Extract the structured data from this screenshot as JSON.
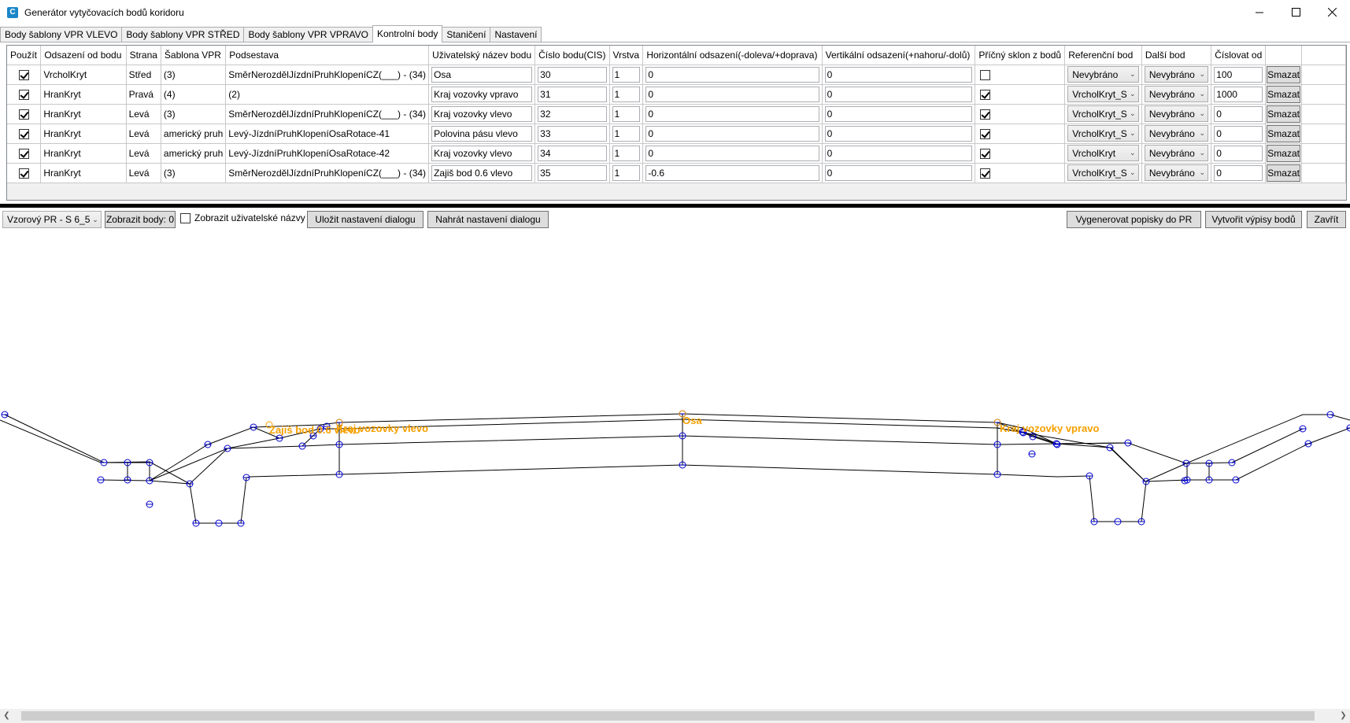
{
  "window": {
    "title": "Generátor vytyčovacích bodů koridoru",
    "minimize_icon": "minimize-icon",
    "maximize_icon": "maximize-icon",
    "close_icon": "close-icon"
  },
  "tabs": [
    {
      "label": "Body šablony VPR VLEVO",
      "active": false
    },
    {
      "label": "Body šablony VPR STŘED",
      "active": false
    },
    {
      "label": "Body šablony VPR VPRAVO",
      "active": false
    },
    {
      "label": "Kontrolní body",
      "active": true
    },
    {
      "label": "Staničení",
      "active": false
    },
    {
      "label": "Nastavení",
      "active": false
    }
  ],
  "grid": {
    "headers": [
      "Použít",
      "Odsazení od bodu",
      "Strana",
      "Šablona VPR",
      "Podsestava",
      "Uživatelský název bodu",
      "Číslo bodu(CIS)",
      "Vrstva",
      "Horizontální odsazení(-doleva/+doprava)",
      "Vertikální odsazení(+nahoru/-dolů)",
      "Příčný sklon z bodů",
      "Referenční bod",
      "Další bod",
      "Číslovat od",
      ""
    ],
    "rows": [
      {
        "use": true,
        "offset_from": "VrcholKryt",
        "side": "Střed",
        "template": "(3)",
        "subassembly": "SměrNerozdělJízdníPruhKlopeníCZ(___) - (34)",
        "user_name": "Osa",
        "number": "30",
        "layer": "1",
        "h_offset": "0",
        "v_offset": "0",
        "cross_slope": false,
        "ref_point": "Nevybráno",
        "next_point": "Nevybráno",
        "number_from": "100",
        "delete": "Smazat"
      },
      {
        "use": true,
        "offset_from": "HranKryt",
        "side": "Pravá",
        "template": "(4)",
        "subassembly": "(2)",
        "user_name": "Kraj vozovky vpravo",
        "number": "31",
        "layer": "1",
        "h_offset": "0",
        "v_offset": "0",
        "cross_slope": true,
        "ref_point": "VrcholKryt_S",
        "next_point": "Nevybráno",
        "number_from": "1000",
        "delete": "Smazat"
      },
      {
        "use": true,
        "offset_from": "HranKryt",
        "side": "Levá",
        "template": "(3)",
        "subassembly": "SměrNerozdělJízdníPruhKlopeníCZ(___) - (34)",
        "user_name": "Kraj vozovky vlevo",
        "number": "32",
        "layer": "1",
        "h_offset": "0",
        "v_offset": "0",
        "cross_slope": true,
        "ref_point": "VrcholKryt_S",
        "next_point": "Nevybráno",
        "number_from": "0",
        "delete": "Smazat"
      },
      {
        "use": true,
        "offset_from": "HranKryt",
        "side": "Levá",
        "template": "americký pruh",
        "subassembly": "Levý-JízdníPruhKlopeníOsaRotace-41",
        "user_name": "Polovina pásu vlevo",
        "number": "33",
        "layer": "1",
        "h_offset": "0",
        "v_offset": "0",
        "cross_slope": true,
        "ref_point": "VrcholKryt_S",
        "next_point": "Nevybráno",
        "number_from": "0",
        "delete": "Smazat"
      },
      {
        "use": true,
        "offset_from": "HranKryt",
        "side": "Levá",
        "template": "americký pruh",
        "subassembly": "Levý-JízdníPruhKlopeníOsaRotace-42",
        "user_name": "Kraj vozovky vlevo",
        "number": "34",
        "layer": "1",
        "h_offset": "0",
        "v_offset": "0",
        "cross_slope": true,
        "ref_point": "VrcholKryt",
        "next_point": "Nevybráno",
        "number_from": "0",
        "delete": "Smazat"
      },
      {
        "use": true,
        "offset_from": "HranKryt",
        "side": "Levá",
        "template": "(3)",
        "subassembly": "SměrNerozdělJízdníPruhKlopeníCZ(___) - (34)",
        "user_name": "Zajiš bod 0.6 vlevo",
        "number": "35",
        "layer": "1",
        "h_offset": "-0.6",
        "v_offset": "0",
        "cross_slope": true,
        "ref_point": "VrcholKryt_S",
        "next_point": "Nevybráno",
        "number_from": "0",
        "delete": "Smazat"
      }
    ]
  },
  "toolbar": {
    "template_select": "Vzorový PR - S 6_5",
    "show_points": "Zobrazit body: 0",
    "show_user_names_label": "Zobrazit uživatelské názvy",
    "show_user_names_checked": false,
    "save_settings": "Uložit nastavení dialogu",
    "load_settings": "Nahrát nastavení dialogu",
    "generate_labels": "Vygenerovat popisky do PR",
    "create_listings": "Vytvořit výpisy bodů",
    "close": "Zavřít"
  },
  "preview": {
    "labels": {
      "left_edge": "Zajiš bod 0.6 vlevo",
      "left_road": "Kraj vozovky vlevo",
      "center": "Osa",
      "right_road": "Kraj vozovky vpravo"
    },
    "line_color": "#000000",
    "point_color": "#0000cc",
    "label_color": "#f5a000"
  }
}
